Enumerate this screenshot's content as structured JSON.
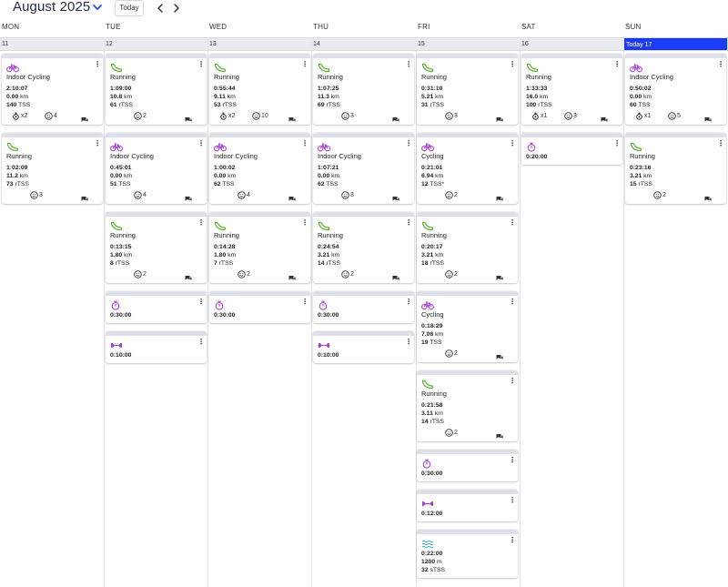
{
  "header": {
    "month_title": "August 2025",
    "today_button": "Today"
  },
  "days": [
    {
      "name": "MON",
      "date": "11"
    },
    {
      "name": "TUE",
      "date": "12"
    },
    {
      "name": "WED",
      "date": "13"
    },
    {
      "name": "THU",
      "date": "14"
    },
    {
      "name": "FRI",
      "date": "15"
    },
    {
      "name": "SAT",
      "date": "16"
    },
    {
      "name": "SUN",
      "date": "Today 17"
    }
  ],
  "colors": {
    "today_blue": "#1c3df5",
    "running_green": "#5cb130",
    "cycling_purple": "#a742d6",
    "swim_teal": "#3aa7c6"
  },
  "cards": [
    {
      "id": "mon-1",
      "day": 0,
      "icon": "bike-icon",
      "title": "Indoor Cycling",
      "metrics": [
        [
          "2:10:07",
          ""
        ],
        [
          "0.00",
          "km"
        ],
        [
          "140",
          "TSS"
        ]
      ],
      "foot": {
        "equip": "x2",
        "feel": "4",
        "chat": true
      }
    },
    {
      "id": "mon-2",
      "day": 0,
      "icon": "shoe-icon",
      "title": "Running",
      "metrics": [
        [
          "1:02:09",
          ""
        ],
        [
          "11.2",
          "km"
        ],
        [
          "73",
          "rTSS"
        ]
      ],
      "foot": {
        "feel": "3",
        "chat": true
      }
    },
    {
      "id": "tue-1",
      "day": 1,
      "icon": "shoe-icon",
      "title": "Running",
      "metrics": [
        [
          "1:09:00",
          ""
        ],
        [
          "10.8",
          "km"
        ],
        [
          "61",
          "rTSS"
        ]
      ],
      "foot": {
        "feel": "2",
        "chat": true
      }
    },
    {
      "id": "tue-2",
      "day": 1,
      "icon": "bike-icon",
      "title": "Indoor Cycling",
      "metrics": [
        [
          "0:45:01",
          ""
        ],
        [
          "0.00",
          "km"
        ],
        [
          "51",
          "TSS"
        ]
      ],
      "foot": {
        "feel": "4",
        "chat": true
      }
    },
    {
      "id": "tue-3",
      "day": 1,
      "icon": "shoe-icon",
      "title": "Running",
      "metrics": [
        [
          "0:13:15",
          ""
        ],
        [
          "1.80",
          "km"
        ],
        [
          "8",
          "rTSS"
        ]
      ],
      "foot": {
        "feel": "2",
        "chat": true
      }
    },
    {
      "id": "tue-4",
      "day": 1,
      "icon": "stopwatch-icon",
      "title": "",
      "metrics": [
        [
          "0:30:00",
          ""
        ]
      ],
      "foot": null
    },
    {
      "id": "tue-5",
      "day": 1,
      "icon": "dumbbell-icon",
      "title": "",
      "metrics": [
        [
          "0:10:00",
          ""
        ]
      ],
      "foot": null
    },
    {
      "id": "wed-1",
      "day": 2,
      "icon": "shoe-icon",
      "title": "Running",
      "metrics": [
        [
          "0:55:44",
          ""
        ],
        [
          "9.11",
          "km"
        ],
        [
          "53",
          "rTSS"
        ]
      ],
      "foot": {
        "equip": "x2",
        "feel": "10",
        "chat": true
      }
    },
    {
      "id": "wed-2",
      "day": 2,
      "icon": "bike-icon",
      "title": "Indoor Cycling",
      "metrics": [
        [
          "1:00:02",
          ""
        ],
        [
          "0.00",
          "km"
        ],
        [
          "62",
          "TSS"
        ]
      ],
      "foot": {
        "feel": "4",
        "chat": true
      }
    },
    {
      "id": "wed-3",
      "day": 2,
      "icon": "shoe-icon",
      "title": "Running",
      "metrics": [
        [
          "0:14:28",
          ""
        ],
        [
          "1.80",
          "km"
        ],
        [
          "7",
          "rTSS"
        ]
      ],
      "foot": {
        "feel": "2",
        "chat": true
      }
    },
    {
      "id": "wed-4",
      "day": 2,
      "icon": "stopwatch-icon",
      "title": "",
      "metrics": [
        [
          "0:30:00",
          ""
        ]
      ],
      "foot": null
    },
    {
      "id": "thu-1",
      "day": 3,
      "icon": "shoe-icon",
      "title": "Running",
      "metrics": [
        [
          "1:07:25",
          ""
        ],
        [
          "11.3",
          "km"
        ],
        [
          "69",
          "rTSS"
        ]
      ],
      "foot": {
        "feel": "3",
        "chat": true
      }
    },
    {
      "id": "thu-2",
      "day": 3,
      "icon": "bike-icon",
      "title": "Indoor Cycling",
      "metrics": [
        [
          "1:07:21",
          ""
        ],
        [
          "0.00",
          "km"
        ],
        [
          "62",
          "TSS"
        ]
      ],
      "foot": {
        "feel": "3",
        "chat": true
      }
    },
    {
      "id": "thu-3",
      "day": 3,
      "icon": "shoe-icon",
      "title": "Running",
      "metrics": [
        [
          "0:24:54",
          ""
        ],
        [
          "3.21",
          "km"
        ],
        [
          "14",
          "rTSS"
        ]
      ],
      "foot": {
        "feel": "2",
        "chat": true
      }
    },
    {
      "id": "thu-4",
      "day": 3,
      "icon": "stopwatch-icon",
      "title": "",
      "metrics": [
        [
          "0:30:00",
          ""
        ]
      ],
      "foot": null
    },
    {
      "id": "thu-5",
      "day": 3,
      "icon": "dumbbell-icon",
      "title": "",
      "metrics": [
        [
          "0:10:00",
          ""
        ]
      ],
      "foot": null
    },
    {
      "id": "fri-1",
      "day": 4,
      "icon": "shoe-icon",
      "title": "Running",
      "metrics": [
        [
          "0:31:10",
          ""
        ],
        [
          "5.21",
          "km"
        ],
        [
          "31",
          "rTSS"
        ]
      ],
      "foot": {
        "feel": "3",
        "chat": true
      }
    },
    {
      "id": "fri-2",
      "day": 4,
      "icon": "bike-icon",
      "title": "Cycling",
      "metrics": [
        [
          "0:21:01",
          ""
        ],
        [
          "6.94",
          "km"
        ],
        [
          "12",
          "TSS*"
        ]
      ],
      "foot": {
        "feel": "2",
        "chat": true
      }
    },
    {
      "id": "fri-3",
      "day": 4,
      "icon": "shoe-icon",
      "title": "Running",
      "metrics": [
        [
          "0:20:17",
          ""
        ],
        [
          "3.21",
          "km"
        ],
        [
          "18",
          "rTSS"
        ]
      ],
      "foot": {
        "feel": "2",
        "chat": true
      }
    },
    {
      "id": "fri-4",
      "day": 4,
      "icon": "bike-icon",
      "title": "Cycling",
      "metrics": [
        [
          "0:18:29",
          ""
        ],
        [
          "7.06",
          "km"
        ],
        [
          "19",
          "TSS"
        ]
      ],
      "foot": {
        "feel": "2",
        "chat": true
      }
    },
    {
      "id": "fri-5",
      "day": 4,
      "icon": "shoe-icon",
      "title": "Running",
      "metrics": [
        [
          "0:21:58",
          ""
        ],
        [
          "3.11",
          "km"
        ],
        [
          "14",
          "rTSS"
        ]
      ],
      "foot": {
        "feel": "2",
        "chat": true
      }
    },
    {
      "id": "fri-6",
      "day": 4,
      "icon": "stopwatch-icon",
      "title": "",
      "metrics": [
        [
          "0:30:00",
          ""
        ]
      ],
      "foot": null
    },
    {
      "id": "fri-7",
      "day": 4,
      "icon": "dumbbell-icon",
      "title": "",
      "metrics": [
        [
          "0:12:00",
          ""
        ]
      ],
      "foot": null
    },
    {
      "id": "fri-8",
      "day": 4,
      "icon": "swim-icon",
      "title": "",
      "metrics": [
        [
          "0:22:00",
          ""
        ],
        [
          "1200",
          "m"
        ],
        [
          "32",
          "sTSS"
        ]
      ],
      "foot": null
    },
    {
      "id": "sat-1",
      "day": 5,
      "icon": "shoe-icon",
      "title": "Running",
      "metrics": [
        [
          "1:33:33",
          ""
        ],
        [
          "16.0",
          "km"
        ],
        [
          "100",
          "rTSS"
        ]
      ],
      "foot": {
        "equip": "x1",
        "feel": "3",
        "chat": true
      }
    },
    {
      "id": "sat-2",
      "day": 5,
      "icon": "stopwatch-icon",
      "title": "",
      "metrics": [
        [
          "0:20:00",
          ""
        ]
      ],
      "foot": null
    },
    {
      "id": "sun-1",
      "day": 6,
      "icon": "bike-icon",
      "title": "Indoor Cycling",
      "metrics": [
        [
          "0:50:02",
          ""
        ],
        [
          "0.00",
          "km"
        ],
        [
          "60",
          "TSS"
        ]
      ],
      "foot": {
        "equip": "x1",
        "feel": "5",
        "chat": true
      }
    },
    {
      "id": "sun-2",
      "day": 6,
      "icon": "shoe-icon",
      "title": "Running",
      "metrics": [
        [
          "0:23:16",
          ""
        ],
        [
          "3.21",
          "km"
        ],
        [
          "15",
          "rTSS"
        ]
      ],
      "foot": {
        "feel": "2",
        "chat": true
      }
    }
  ]
}
